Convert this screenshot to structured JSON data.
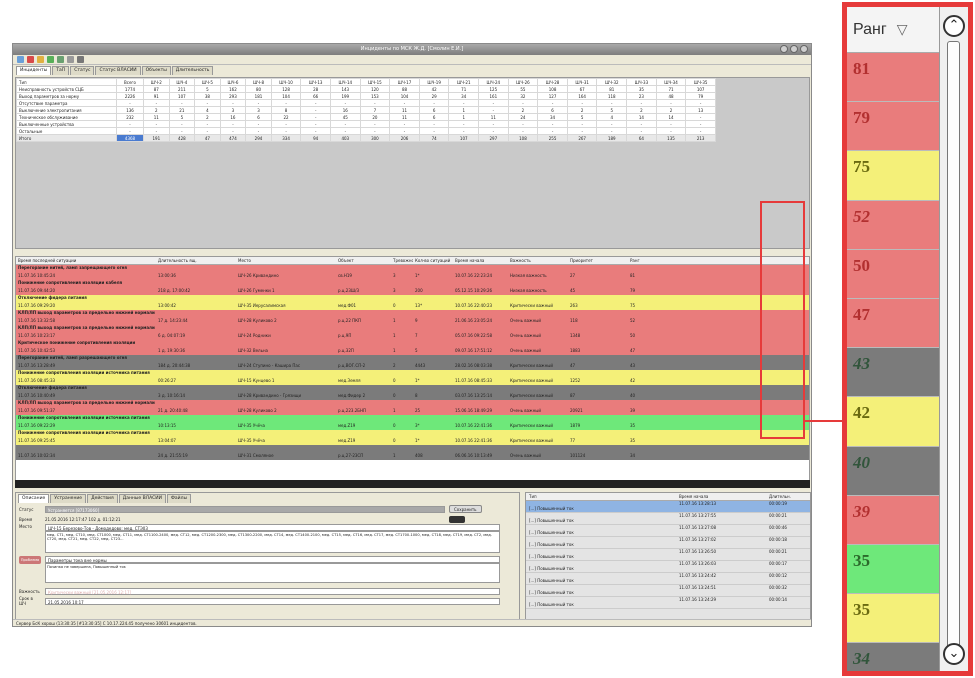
{
  "window": {
    "title": "Инциденты по МСК Ж.Д. [Смолин Е.И.]"
  },
  "tabs": [
    "Инциденты",
    "ТаП",
    "Статус",
    "Статус ВЛАСИИ",
    "Объекты",
    "Длительность"
  ],
  "summary": {
    "columns": [
      "Тип",
      "Всего",
      "ШЧ-2",
      "ШЧ-4",
      "ШЧ-5",
      "ШЧ-6",
      "ШЧ-8",
      "ШЧ-10",
      "ШЧ-13",
      "ШЧ-14",
      "ШЧ-15",
      "ШЧ-17",
      "ШЧ-19",
      "ШЧ-21",
      "ШЧ-24",
      "ШЧ-26",
      "ШЧ-28",
      "ШЧ-31",
      "ШЧ-32",
      "ШЧ-33",
      "ШЧ-34",
      "ШЧ-35"
    ],
    "rows": [
      [
        "Неисправность устройств СЦБ",
        "1774",
        "87",
        "211",
        "5",
        "162",
        "80",
        "128",
        "28",
        "143",
        "120",
        "88",
        "42",
        "71",
        "125",
        "55",
        "108",
        "67",
        "81",
        "35",
        "71",
        "107"
      ],
      [
        "Выход параметров за норму",
        "2226",
        "91",
        "107",
        "38",
        "293",
        "181",
        "104",
        "66",
        "199",
        "153",
        "104",
        "29",
        "34",
        "161",
        "32",
        "127",
        "164",
        "118",
        "23",
        "48",
        "79"
      ],
      [
        "Отсутствие параметра",
        "-",
        "-",
        "-",
        "-",
        "-",
        "-",
        "-",
        "-",
        "-",
        "-",
        "-",
        "-",
        "-",
        "-",
        "-",
        "-",
        "-",
        "-",
        "-",
        "-",
        "-"
      ],
      [
        "Выключение электропитания",
        "136",
        "2",
        "21",
        "4",
        "3",
        "3",
        "8",
        "-",
        "16",
        "7",
        "11",
        "6",
        "1",
        "-",
        "2",
        "6",
        "2",
        "5",
        "2",
        "2",
        "13"
      ],
      [
        "Техническое обслуживание",
        "232",
        "11",
        "5",
        "2",
        "16",
        "6",
        "22",
        "-",
        "45",
        "20",
        "11",
        "6",
        "1",
        "11",
        "24",
        "34",
        "5",
        "4",
        "14",
        "14",
        "-"
      ],
      [
        "Выключенные устройства",
        "-",
        "-",
        "-",
        "-",
        "-",
        "-",
        "-",
        "-",
        "-",
        "-",
        "-",
        "-",
        "-",
        "-",
        "-",
        "-",
        "-",
        "-",
        "-",
        "-",
        "-"
      ],
      [
        "Остальные",
        "-",
        "-",
        "-",
        "-",
        "-",
        "-",
        "-",
        "-",
        "-",
        "-",
        "-",
        "-",
        "-",
        "-",
        "-",
        "-",
        "-",
        "-",
        "-",
        "-",
        "-"
      ]
    ],
    "total": [
      "Итого",
      "4368",
      "191",
      "428",
      "47",
      "474",
      "294",
      "334",
      "94",
      "403",
      "300",
      "206",
      "74",
      "107",
      "297",
      "108",
      "255",
      "267",
      "189",
      "64",
      "135",
      "213"
    ]
  },
  "incidents": {
    "columns": [
      "",
      "Время последней ситуации",
      "Длительность ящ.",
      "Место",
      "Объект",
      "Тревожность",
      "Кол-во ситуаций",
      "Время начала",
      "Важность",
      "Приоритет",
      "Ранг"
    ],
    "groups": [
      {
        "title": "Перегорание нитей, ламп запрещающего огня",
        "color": "red",
        "row": [
          "",
          "11.07.16 10:45:24",
          "13:00:36",
          "ШЧ-26 Кривандино",
          "св.Н19",
          "3",
          "1*",
          "10.07.16 22:23:24",
          "Низкая важность",
          "27",
          "81"
        ]
      },
      {
        "title": "Понижение сопротивления изоляции кабеля",
        "color": "red",
        "row": [
          "",
          "11.07.16 09:44:20",
          "218 д. 17:00:42",
          "ШЧ-26 Гуменки 1",
          "р.ц.23Ш/3",
          "3",
          "200",
          "05.12.15 10:29:26",
          "Низкая важность",
          "45",
          "79"
        ]
      },
      {
        "title": "Отключение фидера питания",
        "color": "yellow",
        "row": [
          "",
          "11.07.16 09:29:20",
          "13:00:42",
          "ШЧ-35 Иерусалимская",
          "мед.Ф01",
          "0",
          "13*",
          "10.07.16 22:40:23",
          "Критически важный",
          "263",
          "75"
        ]
      },
      {
        "title": "КЛП/ЛП выход параметров за предельно нижней нормали",
        "color": "red",
        "row": [
          "",
          "11.07.16 13:32:58",
          "17 д. 14:23:44",
          "ШЧ-28 Куликово 2",
          "р.ц.22 ПКП",
          "1",
          "9",
          "21.06.16 23:05:24",
          "Очень важный",
          "118",
          "52"
        ]
      },
      {
        "title": "КЛП/ЛП выход параметров за предельно нижней нормали",
        "color": "red",
        "row": [
          "",
          "11.07.16 10:23:17",
          "6 д. 04:07:19",
          "ШЧ-24 Родники",
          "р.ц.9П",
          "1",
          "7",
          "05.07.16 09:22:58",
          "Очень важный",
          "1348",
          "50"
        ]
      },
      {
        "title": "Критическое понижение сопротивления изоляции",
        "color": "red",
        "row": [
          "",
          "11.07.16 10:42:53",
          "1 д. 19:30:36",
          "ШЧ-32 Вельна",
          "р.ц.32П",
          "1",
          "5",
          "09.07.16 17:51:12",
          "Очень важный",
          "1883",
          "47"
        ]
      },
      {
        "title": "Перегорание нитей, ламп разрешающего огня",
        "color": "gray",
        "row": [
          "",
          "11.07.16 13:28:49",
          "184 д. 20:44:38",
          "ШЧ-24 Ступино - Кашира Пас",
          "р.ц.ВОГ.СП-2",
          "2",
          "4443",
          "28.02.16 08:03:38",
          "Критически важный",
          "47",
          "43"
        ]
      },
      {
        "title": "Понижение сопротивления изоляции источника питания",
        "color": "yellow",
        "row": [
          "",
          "11.07.16 08:45:33",
          "00:26:27",
          "ШЧ-15 Кунцево 1",
          "мед.Земля",
          "0",
          "1*",
          "11.07.16 08:45:33",
          "Критически важный",
          "1252",
          "42"
        ]
      },
      {
        "title": "Отключение фидера питания",
        "color": "gray",
        "row": [
          "",
          "11.07.16 10:40:49",
          "3 д. 10:16:14",
          "ШЧ-28 Кривандино - Грязищи",
          "мед.Фидер 2",
          "0",
          "8",
          "03.07.16 13:25:14",
          "Критически важный",
          "87",
          "40"
        ]
      },
      {
        "title": "КЛП/ЛП выход параметров за предельно нижней нормали",
        "color": "red",
        "row": [
          "",
          "11.07.16 09:51:37",
          "21 д. 20:40:48",
          "ШЧ-28 Куликово 2",
          "р.ц.223.2БНП",
          "1",
          "25",
          "15.06.16 18:49:29",
          "Очень важный",
          "20921",
          "39"
        ]
      },
      {
        "title": "Понижение сопротивления изоляции источника питания",
        "color": "green",
        "row": [
          "",
          "11.07.16 09:22:29",
          "10:13:15",
          "ШЧ-35 Учёча",
          "мед.Z19",
          "0",
          "3*",
          "10.07.16 22:41:36",
          "Критически важный",
          "1879",
          "35"
        ]
      },
      {
        "title": "Понижение сопротивления изоляции источника питания",
        "color": "yellow",
        "row": [
          "",
          "11.07.16 09:25:45",
          "13:04:07",
          "ШЧ-35 Учёча",
          "мед.Z19",
          "0",
          "1*",
          "10.07.16 22:41:36",
          "Критически важный",
          "77",
          "35"
        ]
      },
      {
        "title": "",
        "color": "gray",
        "row": [
          "",
          "11.07.16 10:02:34",
          "24 д. 21:55:19",
          "ШЧ-31 Смоляное",
          "р.ц.27-23СП",
          "1",
          "408",
          "06.06.16 10:13:49",
          "Очень важный",
          "101124",
          "34"
        ]
      }
    ]
  },
  "detail": {
    "tabs": [
      "Описание",
      "Устранение",
      "Действия",
      "Данные ВЛАСИИ",
      "Файлы"
    ],
    "status_label": "Статус",
    "status_value": "Устраняется [87173060]",
    "save_button": "Сохранить",
    "time_label": "Время",
    "time_value": "21.05.2016 12:17:47   102 д. 01:12:21",
    "time_badge": "",
    "place_label": "Место",
    "place_value": "ШЧ-15 Березово-Тов - Домодедово: мед. СТЭ03",
    "place_text": "мед. СТ1, мед. СТ10, мед. СТ1000, мед. СТ11, мед. СТ1100-2400, мед. СТ12, мед. СТ1200-2300, мед. СТ1300-2200, мед. СТ14, мед. СТ1400-2100, мед. СТ15, мед. СТ16, мед. СТ17, мед. СТ1700-1000, мед. СТ18, мед. СТ19, мед. СТ2, мед. СТ20, мед. СТ21, мед. СТ22, мед. СТ23...",
    "problem_label": "Проблема",
    "problem_value": "Параметры тока вне нормы",
    "problem_text": "Починка не завершена, Повышенный ток",
    "importance_label": "Важность",
    "importance_value": "Критически важный [21.05.2016 12:17]",
    "deadline_label": "Срок в ШЧ",
    "deadline_value": "21.05.2016 10:17"
  },
  "events": {
    "columns": [
      "Тип",
      "Время начала",
      "Длительн."
    ],
    "rows": [
      {
        "type": "[...] Повышенный ток",
        "start": "11.07.16 13:28:13",
        "duration": "00:00:19",
        "selected": true
      },
      {
        "type": "[...] Повышенный ток",
        "start": "11.07.16 13:27:55",
        "duration": "00:00:21",
        "selected": false
      },
      {
        "type": "[...] Повышенный ток",
        "start": "11.07.16 13:27:08",
        "duration": "00:00:46",
        "selected": false
      },
      {
        "type": "[...] Повышенный ток",
        "start": "11.07.16 13:27:02",
        "duration": "00:00:18",
        "selected": false
      },
      {
        "type": "[...] Повышенный ток",
        "start": "11.07.16 13:26:50",
        "duration": "00:00:21",
        "selected": false
      },
      {
        "type": "[...] Повышенный ток",
        "start": "11.07.16 13:26:03",
        "duration": "00:00:17",
        "selected": false
      },
      {
        "type": "[...] Повышенный ток",
        "start": "11.07.16 13:24:42",
        "duration": "00:00:12",
        "selected": false
      },
      {
        "type": "[...] Повышенный ток",
        "start": "11.07.16 13:24:51",
        "duration": "00:00:32",
        "selected": false
      },
      {
        "type": "[...] Повышенный ток",
        "start": "11.07.16 13:24:29",
        "duration": "00:00:14",
        "selected": false
      }
    ]
  },
  "statusbar": "Сервер БсК хорош (13:30:35 [#13:30:35]   С 10.17.224.45 получено 30601 инцидентов.",
  "zoom": {
    "header": "Ранг",
    "filter_icon": "filter-icon",
    "ranks": [
      {
        "value": "81",
        "color": "red",
        "italic": false
      },
      {
        "value": "79",
        "color": "red",
        "italic": false
      },
      {
        "value": "75",
        "color": "yellow",
        "italic": false
      },
      {
        "value": "52",
        "color": "red",
        "italic": true
      },
      {
        "value": "50",
        "color": "red",
        "italic": false
      },
      {
        "value": "47",
        "color": "red",
        "italic": false
      },
      {
        "value": "43",
        "color": "gray",
        "italic": true
      },
      {
        "value": "42",
        "color": "yellow",
        "italic": false
      },
      {
        "value": "40",
        "color": "gray",
        "italic": true
      },
      {
        "value": "39",
        "color": "red",
        "italic": true
      },
      {
        "value": "35",
        "color": "green",
        "italic": false
      },
      {
        "value": "35",
        "color": "yellow",
        "italic": false
      },
      {
        "value": "34",
        "color": "gray",
        "italic": true
      }
    ]
  },
  "colors": {
    "red": "#e97c7c",
    "yellow": "#f4f079",
    "gray": "#7b7b7b",
    "green": "#6ee87a",
    "highlight": "#e63a3a"
  }
}
